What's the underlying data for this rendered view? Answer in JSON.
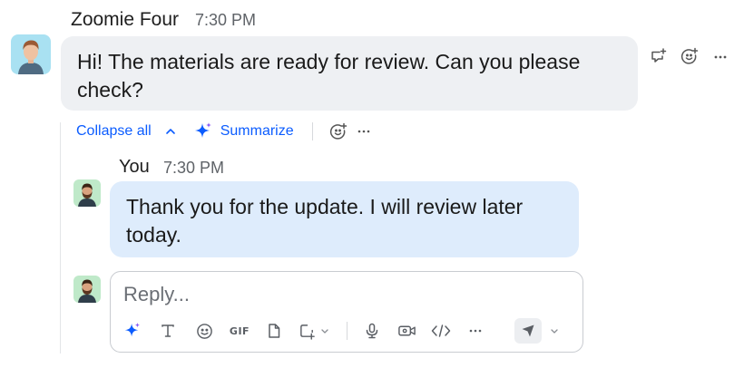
{
  "message": {
    "sender": "Zoomie Four",
    "time": "7:30 PM",
    "text": "Hi! The materials are ready for review. Can you please check?"
  },
  "message_actions": [
    "reply-in-thread-icon",
    "add-reaction-icon",
    "more-icon"
  ],
  "thread_bar": {
    "collapse_label": "Collapse all",
    "summarize_label": "Summarize"
  },
  "reply": {
    "sender": "You",
    "time": "7:30 PM",
    "text": "Thank you for the update. I will review later today."
  },
  "composer": {
    "placeholder": "Reply...",
    "value": "",
    "gif_label": "GIF",
    "tools": [
      "ai-sparkle-icon",
      "format-text-icon",
      "emoji-icon",
      "gif-icon",
      "file-icon",
      "screenshot-icon",
      "microphone-icon",
      "video-clip-icon",
      "code-icon",
      "more-icon",
      "send-icon"
    ]
  },
  "colors": {
    "accent": "#0b5cff",
    "incoming_bubble": "#eef0f3",
    "outgoing_bubble": "#deecfc"
  }
}
